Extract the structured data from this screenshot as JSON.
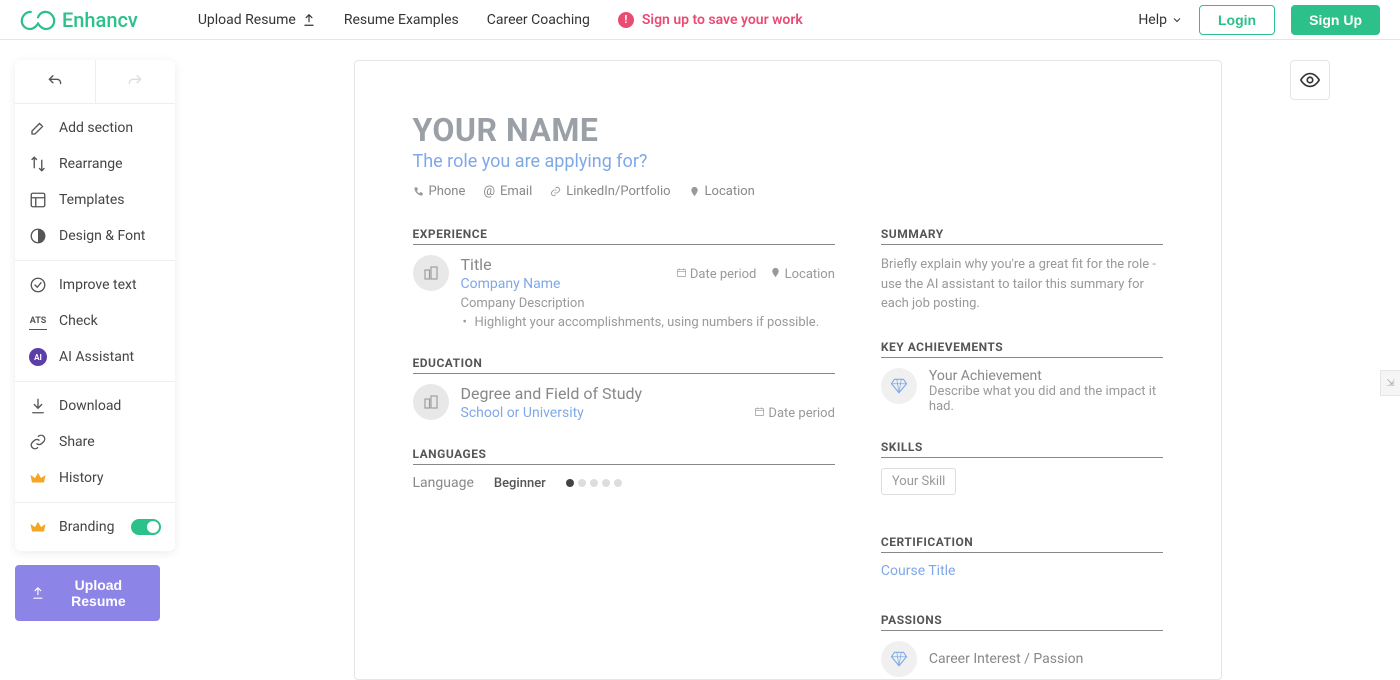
{
  "brand": "Enhancv",
  "nav": {
    "upload": "Upload Resume",
    "examples": "Resume Examples",
    "coaching": "Career Coaching",
    "signup_msg": "Sign up to save your work"
  },
  "header": {
    "help": "Help",
    "login": "Login",
    "signup": "Sign Up"
  },
  "sidebar": {
    "add_section": "Add section",
    "rearrange": "Rearrange",
    "templates": "Templates",
    "design_font": "Design & Font",
    "improve_text": "Improve text",
    "check": "Check",
    "ai_assistant": "AI Assistant",
    "download": "Download",
    "share": "Share",
    "history": "History",
    "branding": "Branding",
    "upload_resume": "Upload Resume"
  },
  "resume": {
    "name": "YOUR NAME",
    "role": "The role you are applying for?",
    "contacts": {
      "phone": "Phone",
      "email": "Email",
      "linkedin": "LinkedIn/Portfolio",
      "location": "Location"
    },
    "sections": {
      "experience": "EXPERIENCE",
      "education": "EDUCATION",
      "languages": "LANGUAGES",
      "summary": "SUMMARY",
      "key_achievements": "KEY ACHIEVEMENTS",
      "skills": "SKILLS",
      "certification": "CERTIFICATION",
      "passions": "PASSIONS"
    },
    "experience": {
      "title": "Title",
      "company": "Company Name",
      "date": "Date period",
      "location": "Location",
      "description": "Company Description",
      "bullet": "Highlight your accomplishments, using numbers if possible."
    },
    "education": {
      "degree": "Degree and Field of Study",
      "school": "School or University",
      "date": "Date period"
    },
    "languages": {
      "label": "Language",
      "level": "Beginner",
      "filled": 1,
      "total": 5
    },
    "summary": "Briefly explain why you're a great fit for the role - use the AI assistant to tailor this summary for each job posting.",
    "achievement": {
      "title": "Your Achievement",
      "desc": "Describe what you did and the impact it had."
    },
    "skill": "Your Skill",
    "cert": "Course Title",
    "passion": "Career Interest / Passion"
  }
}
